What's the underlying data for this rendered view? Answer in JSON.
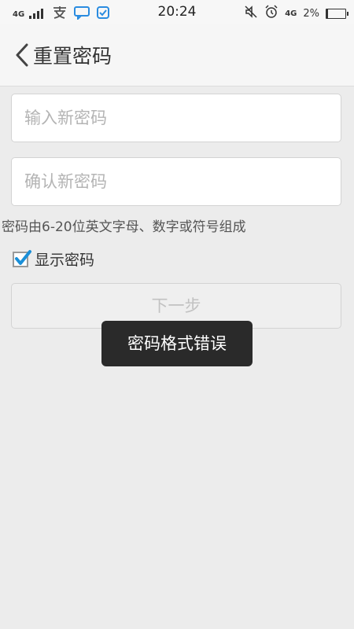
{
  "status_bar": {
    "network": "4G",
    "time": "20:24",
    "network_right": "4G",
    "battery": "2%",
    "battery_level": 0.02,
    "icons_left": [
      "signal-icon",
      "alipay-icon",
      "chat-icon",
      "shield-icon"
    ],
    "icons_right": [
      "mute-icon",
      "alarm-icon"
    ]
  },
  "header": {
    "title": "重置密码"
  },
  "form": {
    "new_password_placeholder": "输入新密码",
    "confirm_password_placeholder": "确认新密码",
    "hint": "密码由6-20位英文字母、数字或符号组成",
    "show_password_label": "显示密码",
    "show_password_checked": true,
    "next_button": "下一步"
  },
  "toast": {
    "message": "密码格式错误"
  },
  "colors": {
    "check_accent": "#1a8fd8",
    "toast_bg": "#2a2a2a",
    "page_bg": "#ececec"
  }
}
